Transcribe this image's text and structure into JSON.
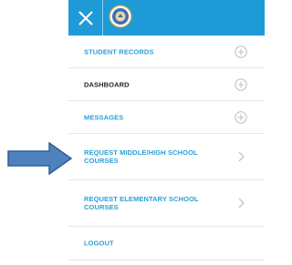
{
  "header": {
    "close_icon": "close-icon",
    "logo_icon": "school-seal-logo",
    "background_color": "#1e9bd7"
  },
  "menu": {
    "items": [
      {
        "label": "STUDENT RECORDS",
        "icon": "plus-circle-icon"
      },
      {
        "label": "DASHBOARD",
        "icon": "plus-circle-icon"
      },
      {
        "label": "MESSAGES",
        "icon": "plus-circle-icon"
      },
      {
        "label": "REQUEST MIDDLE/HIGH SCHOOL COURSES",
        "icon": "chevron-right-icon"
      },
      {
        "label": "REQUEST ELEMENTARY SCHOOL COURSES",
        "icon": "chevron-right-icon"
      },
      {
        "label": "LOGOUT"
      }
    ]
  },
  "annotation": {
    "icon": "right-arrow-icon",
    "color": "#4f81bd"
  }
}
